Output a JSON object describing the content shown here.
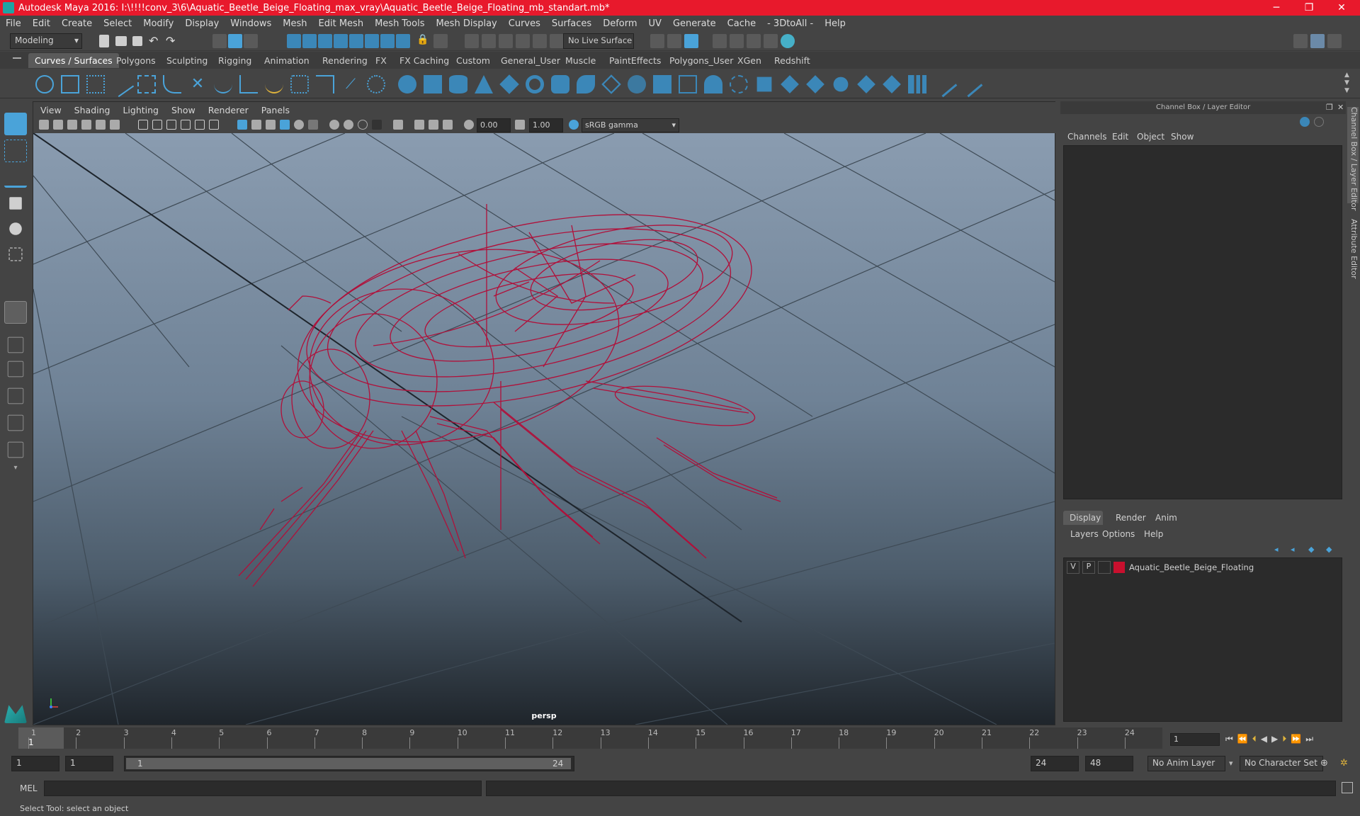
{
  "window": {
    "title": "Autodesk Maya 2016: I:\\!!!!conv_3\\6\\Aquatic_Beetle_Beige_Floating_max_vray\\Aquatic_Beetle_Beige_Floating_mb_standart.mb*",
    "minimize": "─",
    "restore": "❐",
    "close": "✕"
  },
  "menubar": [
    "File",
    "Edit",
    "Create",
    "Select",
    "Modify",
    "Display",
    "Windows",
    "Mesh",
    "Edit Mesh",
    "Mesh Tools",
    "Mesh Display",
    "Curves",
    "Surfaces",
    "Deform",
    "UV",
    "Generate",
    "Cache",
    "- 3DtoAll -",
    "Help"
  ],
  "statusline": {
    "mode": "Modeling",
    "live_surface": "No Live Surface"
  },
  "shelf_tabs": [
    "Curves / Surfaces",
    "Polygons",
    "Sculpting",
    "Rigging",
    "Animation",
    "Rendering",
    "FX",
    "FX Caching",
    "Custom",
    "General_User",
    "Muscle",
    "PaintEffects",
    "Polygons_User",
    "XGen",
    "Redshift"
  ],
  "viewport": {
    "menu": [
      "View",
      "Shading",
      "Lighting",
      "Show",
      "Renderer",
      "Panels"
    ],
    "exposure": "0.00",
    "gamma": "1.00",
    "color_space": "sRGB gamma",
    "camera_label": "persp"
  },
  "channel_box": {
    "title": "Channel Box / Layer Editor",
    "menu": [
      "Channels",
      "Edit",
      "Object",
      "Show"
    ]
  },
  "layer_editor": {
    "tabs": [
      "Display",
      "Render",
      "Anim"
    ],
    "menu": [
      "Layers",
      "Options",
      "Help"
    ],
    "layer": {
      "v": "V",
      "p": "P",
      "name": "Aquatic_Beetle_Beige_Floating",
      "color": "#c8102e"
    }
  },
  "side_tabs": [
    "Channel Box / Layer Editor",
    "Attribute Editor"
  ],
  "timeline": {
    "ticks": [
      "1",
      "2",
      "3",
      "4",
      "5",
      "6",
      "7",
      "8",
      "9",
      "10",
      "11",
      "12",
      "13",
      "14",
      "15",
      "16",
      "17",
      "18",
      "19",
      "20",
      "21",
      "22",
      "23",
      "24"
    ],
    "current_frame_marker": "1",
    "current_frame_field": "1"
  },
  "range": {
    "start": "1",
    "anim_start": "1",
    "slider_start": "1",
    "slider_end": "24",
    "anim_end": "24",
    "end": "48",
    "anim_layer": "No Anim Layer",
    "character_set": "No Character Set"
  },
  "command_line": {
    "label": "MEL"
  },
  "help_line": "Select Tool: select an object",
  "colors": {
    "title_bar": "#e8192c",
    "wireframe": "#b0103a",
    "accent": "#4aa3d9"
  }
}
